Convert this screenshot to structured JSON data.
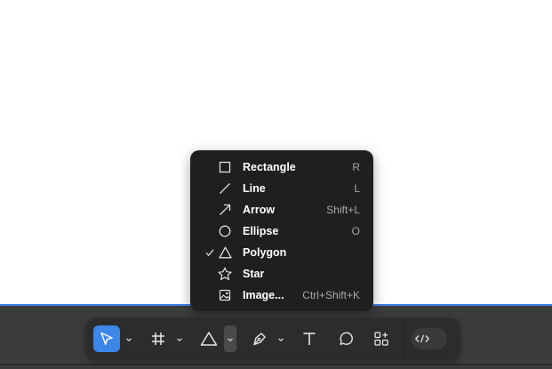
{
  "shape_menu": {
    "items": [
      {
        "label": "Rectangle",
        "shortcut": "R",
        "icon": "rectangle-icon",
        "checked": false
      },
      {
        "label": "Line",
        "shortcut": "L",
        "icon": "line-icon",
        "checked": false
      },
      {
        "label": "Arrow",
        "shortcut": "Shift+L",
        "icon": "arrow-icon",
        "checked": false
      },
      {
        "label": "Ellipse",
        "shortcut": "O",
        "icon": "ellipse-icon",
        "checked": false
      },
      {
        "label": "Polygon",
        "shortcut": "",
        "icon": "polygon-icon",
        "checked": true
      },
      {
        "label": "Star",
        "shortcut": "",
        "icon": "star-icon",
        "checked": false
      },
      {
        "label": "Image...",
        "shortcut": "Ctrl+Shift+K",
        "icon": "image-icon",
        "checked": false
      }
    ]
  },
  "toolbar": {
    "tools": [
      {
        "name": "move-tool",
        "icon": "cursor-icon",
        "active": true
      },
      {
        "name": "frame-tool",
        "icon": "hash-frame-icon",
        "active": false
      },
      {
        "name": "shape-tool",
        "icon": "triangle-icon",
        "active": false
      },
      {
        "name": "pen-tool",
        "icon": "pen-icon",
        "active": false
      },
      {
        "name": "text-tool",
        "icon": "text-icon",
        "active": false
      },
      {
        "name": "comment-tool",
        "icon": "comment-icon",
        "active": false
      },
      {
        "name": "actions-tool",
        "icon": "actions-icon",
        "active": false
      },
      {
        "name": "dev-mode-toggle",
        "icon": "code-icon",
        "active": false
      }
    ]
  },
  "colors": {
    "accent": "#3d86ea",
    "menu_bg": "#1f1f1f",
    "toolbar_bg": "#2c2c2c",
    "selection_border": "#3d7de0"
  }
}
